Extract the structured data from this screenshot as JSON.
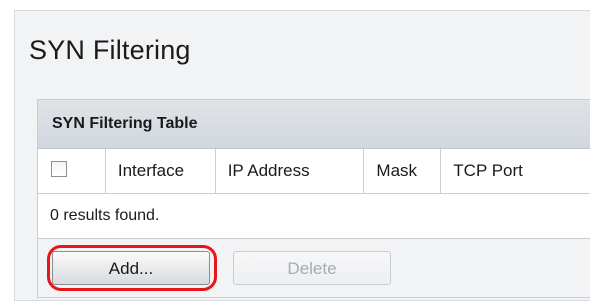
{
  "page": {
    "title": "SYN Filtering"
  },
  "table": {
    "caption": "SYN Filtering Table",
    "columns": [
      "Interface",
      "IP Address",
      "Mask",
      "TCP Port"
    ],
    "select_all_checked": false,
    "results_text": "0 results found."
  },
  "buttons": {
    "add_label": "Add...",
    "delete_label": "Delete",
    "delete_enabled": false,
    "highlight_color": "#e8161b"
  }
}
